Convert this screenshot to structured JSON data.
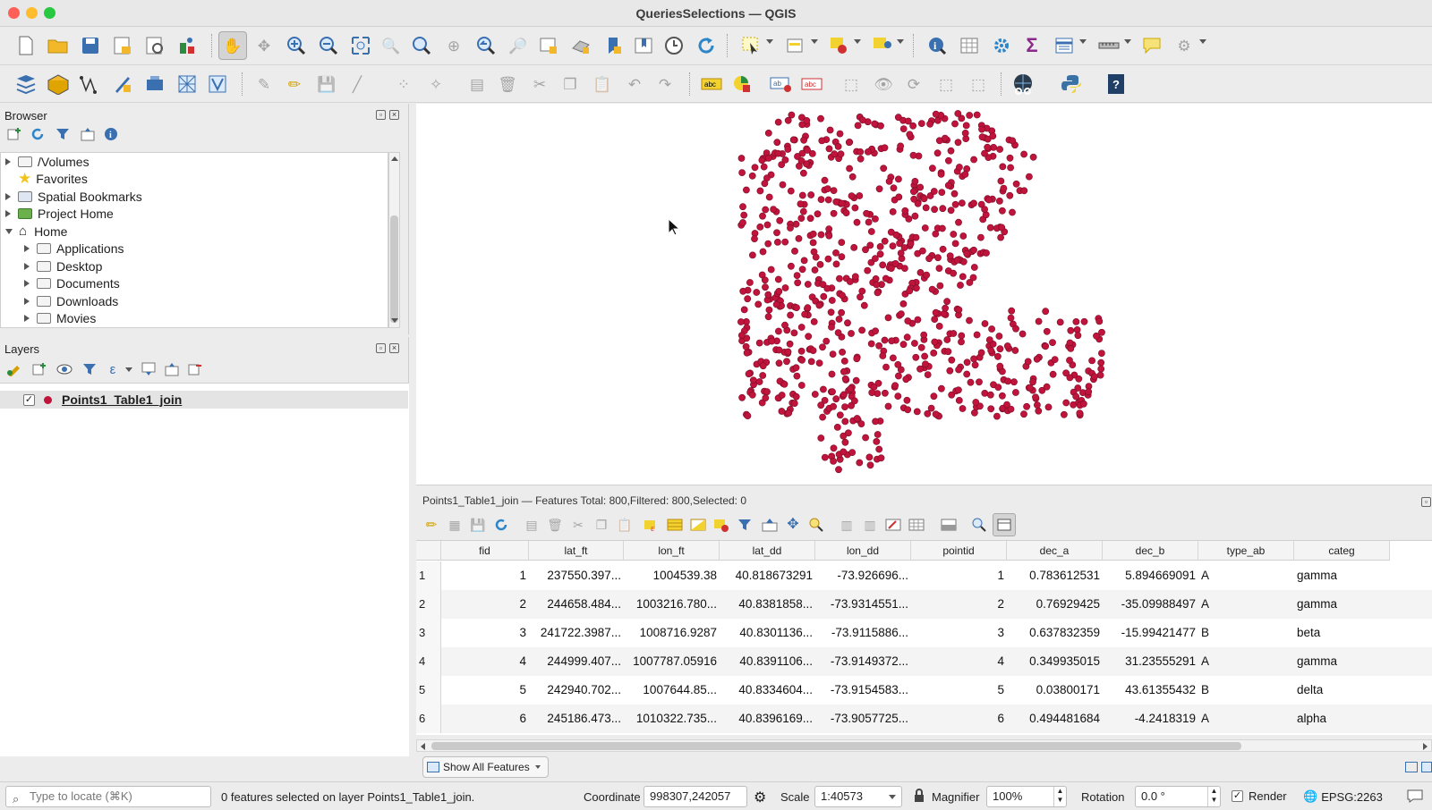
{
  "window": {
    "title": "QueriesSelections — QGIS"
  },
  "colors": {
    "point": "#c0143c",
    "selection_row": "#e4e4e4"
  },
  "toolbar1": {
    "icons": [
      "new-project-icon",
      "open-project-icon",
      "save-project-icon",
      "print-layout-icon",
      "layout-manager-icon",
      "style-manager-icon",
      "pan-icon",
      "pan-to-selection-icon",
      "zoom-in-icon",
      "zoom-out-icon",
      "zoom-full-icon",
      "zoom-selection-icon",
      "zoom-layer-icon",
      "zoom-native-icon",
      "zoom-last-icon",
      "zoom-next-icon",
      "new-map-view-icon",
      "new-3d-view-icon",
      "new-bookmark-icon",
      "show-bookmarks-icon",
      "temporal-controller-icon",
      "refresh-icon",
      "select-features-icon",
      "select-by-value-icon",
      "deselect-icon",
      "select-location-icon",
      "identify-icon",
      "attribute-table-icon",
      "processing-toolbox-icon",
      "statistics-icon",
      "open-field-calculator-icon",
      "measure-icon",
      "map-tips-icon",
      "plugin-icon"
    ]
  },
  "browser": {
    "title": "Browser",
    "items": [
      {
        "label": "/Volumes",
        "indent": 0,
        "arrow": "right",
        "icon": "folder"
      },
      {
        "label": "Favorites",
        "indent": 0,
        "arrow": "none",
        "icon": "star"
      },
      {
        "label": "Spatial Bookmarks",
        "indent": 0,
        "arrow": "right",
        "icon": "bookmark"
      },
      {
        "label": "Project Home",
        "indent": 0,
        "arrow": "right",
        "icon": "project"
      },
      {
        "label": "Home",
        "indent": 0,
        "arrow": "down",
        "icon": "home"
      },
      {
        "label": "Applications",
        "indent": 1,
        "arrow": "right",
        "icon": "folder"
      },
      {
        "label": "Desktop",
        "indent": 1,
        "arrow": "right",
        "icon": "folder"
      },
      {
        "label": "Documents",
        "indent": 1,
        "arrow": "right",
        "icon": "folder"
      },
      {
        "label": "Downloads",
        "indent": 1,
        "arrow": "right",
        "icon": "folder"
      },
      {
        "label": "Movies",
        "indent": 1,
        "arrow": "right",
        "icon": "folder"
      }
    ]
  },
  "layers": {
    "title": "Layers",
    "items": [
      {
        "label": "Points1_Table1_join",
        "checked": true
      }
    ]
  },
  "attribute_table": {
    "header": "Points1_Table1_join — Features Total: 800,Filtered: 800,Selected: 0",
    "columns": [
      "fid",
      "lat_ft",
      "lon_ft",
      "lat_dd",
      "lon_dd",
      "pointid",
      "dec_a",
      "dec_b",
      "type_ab",
      "categ"
    ],
    "rows": [
      [
        "1",
        "1",
        "237550.397...",
        "1004539.38",
        "40.818673291",
        "-73.926696...",
        "1",
        "0.783612531",
        "5.894669091",
        "A",
        "gamma"
      ],
      [
        "2",
        "2",
        "244658.484...",
        "1003216.780...",
        "40.8381858...",
        "-73.9314551...",
        "2",
        "0.76929425",
        "-35.09988497",
        "A",
        "gamma"
      ],
      [
        "3",
        "3",
        "241722.3987...",
        "1008716.9287",
        "40.8301136...",
        "-73.9115886...",
        "3",
        "0.637832359",
        "-15.99421477",
        "B",
        "beta"
      ],
      [
        "4",
        "4",
        "244999.407...",
        "1007787.05916",
        "40.8391106...",
        "-73.9149372...",
        "4",
        "0.349935015",
        "31.23555291",
        "A",
        "gamma"
      ],
      [
        "5",
        "5",
        "242940.702...",
        "1007644.85...",
        "40.8334604...",
        "-73.9154583...",
        "5",
        "0.03800171",
        "43.61355432",
        "B",
        "delta"
      ],
      [
        "6",
        "6",
        "245186.473...",
        "1010322.735...",
        "40.8396169...",
        "-73.9057725...",
        "6",
        "0.494481684",
        "-4.2418319",
        "A",
        "alpha"
      ]
    ],
    "show_all": "Show All Features"
  },
  "statusbar": {
    "locate_placeholder": "Type to locate (⌘K)",
    "message": "0 features selected on layer Points1_Table1_join.",
    "coordinate_label": "Coordinate",
    "coordinate_value": "998307,242057",
    "scale_label": "Scale",
    "scale_value": "1:40573",
    "magnifier_label": "Magnifier",
    "magnifier_value": "100%",
    "rotation_label": "Rotation",
    "rotation_value": "0.0 °",
    "render_label": "Render",
    "crs": "EPSG:2263"
  }
}
